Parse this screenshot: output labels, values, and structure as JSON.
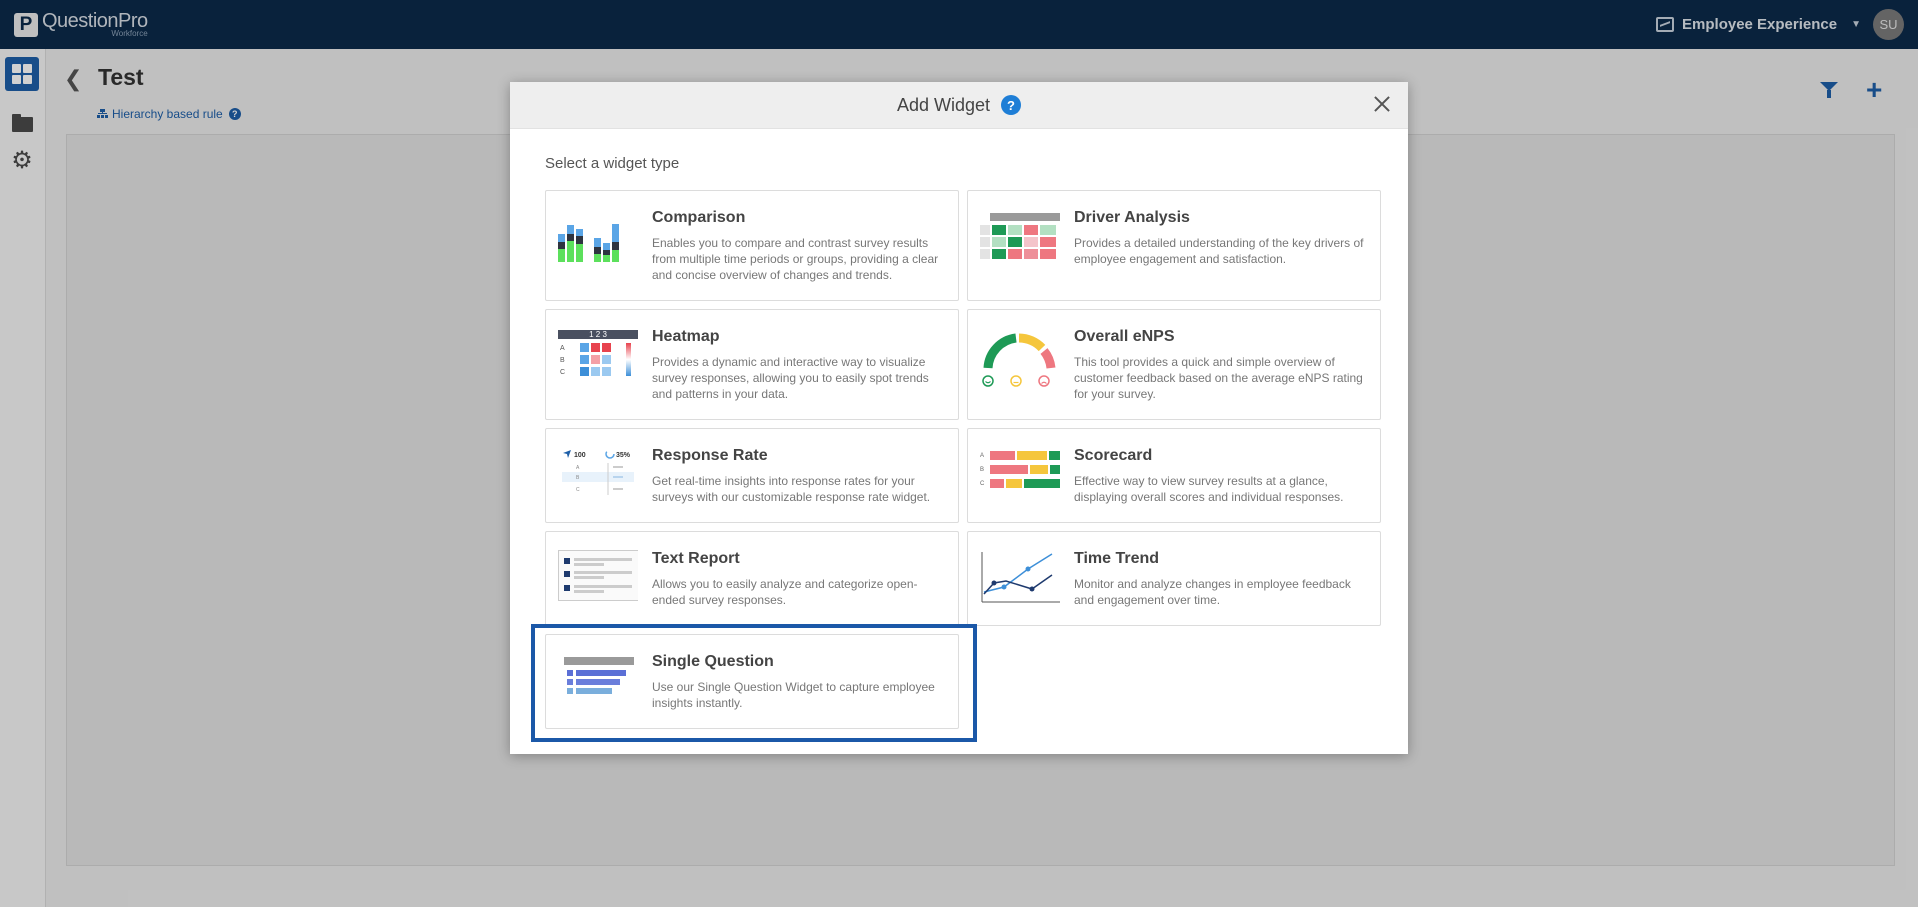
{
  "app": {
    "brand": "QuestionPro",
    "brand_sub": "Workforce",
    "product": "Employee Experience",
    "user_initials": "SU"
  },
  "page": {
    "title": "Test",
    "rule_label": "Hierarchy based rule"
  },
  "modal": {
    "title": "Add Widget",
    "help": "?",
    "subtitle": "Select a widget type",
    "widgets": [
      {
        "id": "comparison",
        "title": "Comparison",
        "description": "Enables you to compare and contrast survey results from multiple time periods or groups, providing a clear and concise overview of changes and trends."
      },
      {
        "id": "driver-analysis",
        "title": "Driver Analysis",
        "description": "Provides a detailed understanding of the key drivers of employee engagement and satisfaction."
      },
      {
        "id": "heatmap",
        "title": "Heatmap",
        "description": "Provides a dynamic and interactive way to visualize survey responses, allowing you to easily spot trends and patterns in your data."
      },
      {
        "id": "overall-enps",
        "title": "Overall eNPS",
        "description": "This tool provides a quick and simple overview of customer feedback based on the average eNPS rating for your survey."
      },
      {
        "id": "response-rate",
        "title": "Response Rate",
        "description": "Get real-time insights into response rates for your surveys with our customizable response rate widget."
      },
      {
        "id": "scorecard",
        "title": "Scorecard",
        "description": "Effective way to view survey results at a glance, displaying overall scores and individual responses."
      },
      {
        "id": "text-report",
        "title": "Text Report",
        "description": "Allows you to easily analyze and categorize open-ended survey responses."
      },
      {
        "id": "time-trend",
        "title": "Time Trend",
        "description": "Monitor and analyze changes in employee feedback and engagement over time."
      },
      {
        "id": "single-question",
        "title": "Single Question",
        "description": "Use our Single Question Widget to capture employee insights instantly."
      }
    ],
    "icon_text": {
      "heatmap_cols": "1 2 3",
      "row_a": "A",
      "row_b": "B",
      "row_c": "C",
      "rr_count": "100",
      "rr_percent": "35%"
    }
  },
  "colors": {
    "topbar": "#0b2a4a",
    "accent": "#1e5fa8",
    "highlight_border": "#1b58a8"
  }
}
